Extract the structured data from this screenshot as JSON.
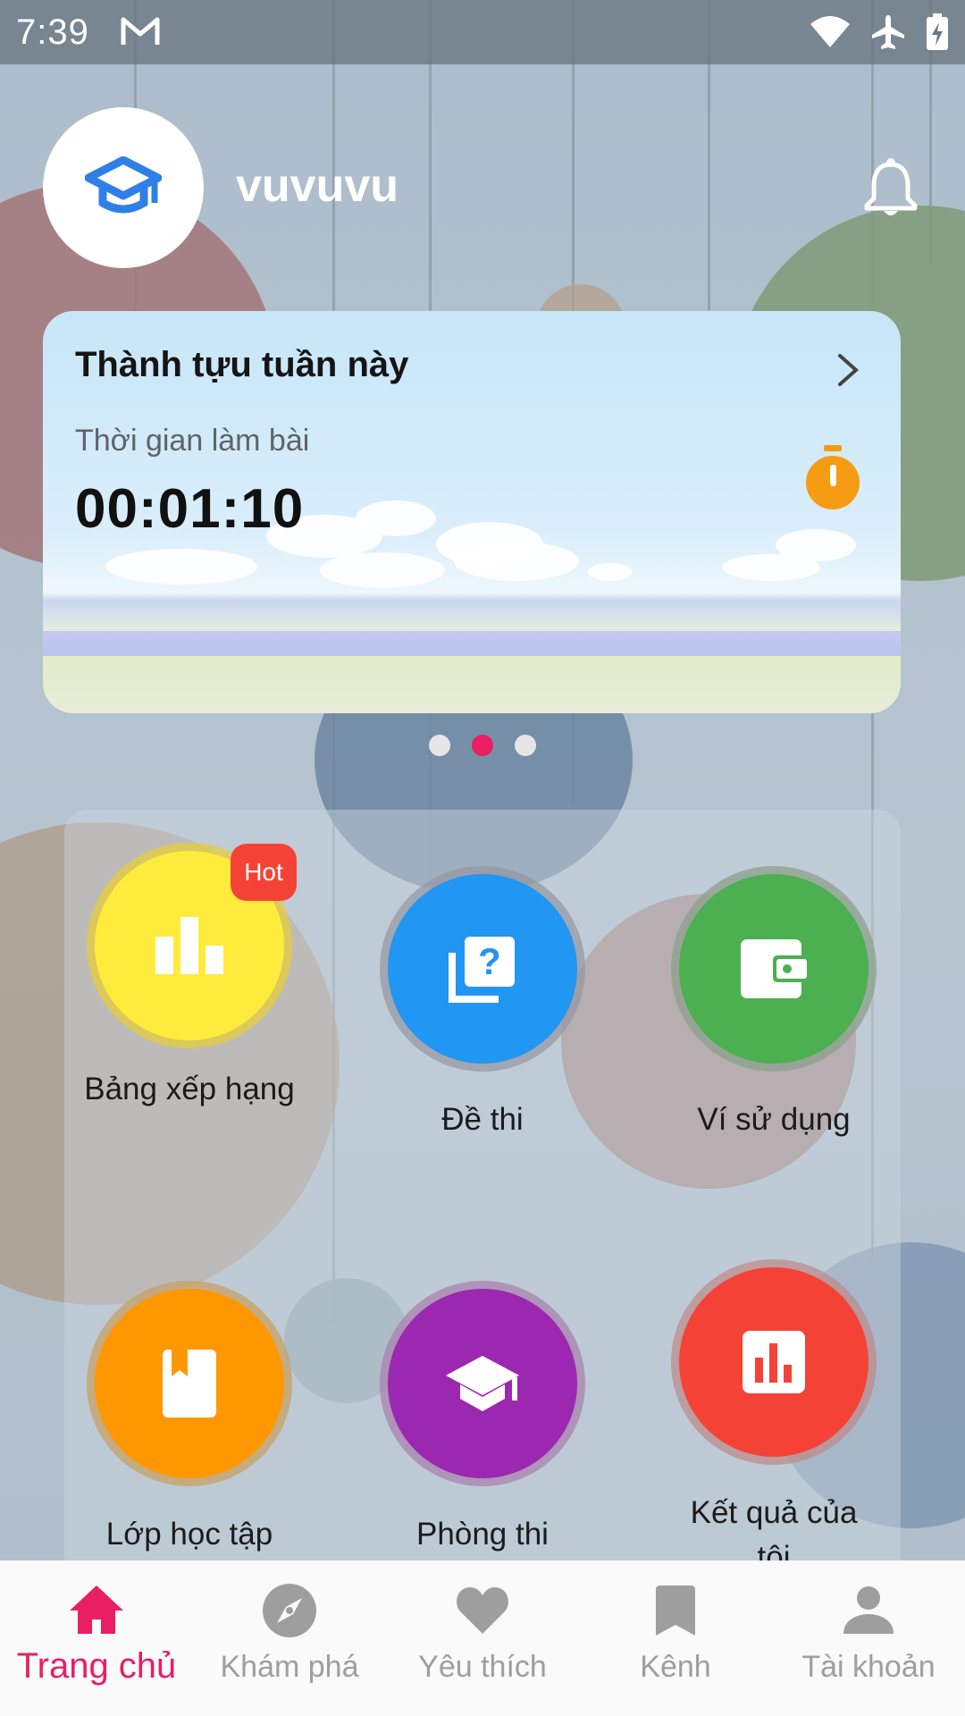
{
  "status_bar": {
    "time": "7:39"
  },
  "header": {
    "username": "vuvuvu"
  },
  "achievement_card": {
    "title": "Thành tựu tuần này",
    "label": "Thời gian làm bài",
    "value": "00:01:10"
  },
  "carousel": {
    "page_count": 3,
    "active_index": 1
  },
  "menu": {
    "items": [
      {
        "label": "Bảng xếp hạng",
        "color": "#ffeb3b",
        "icon": "leaderboard-icon",
        "badge": "Hot"
      },
      {
        "label": "Đề thi",
        "color": "#2196f3",
        "icon": "quiz-icon"
      },
      {
        "label": "Ví sử dụng",
        "color": "#4caf50",
        "icon": "wallet-icon"
      },
      {
        "label": "Lớp học tập",
        "color": "#ff9800",
        "icon": "book-icon"
      },
      {
        "label": "Phòng thi",
        "color": "#9c27b0",
        "icon": "school-icon"
      },
      {
        "label": "Kết quả của tôi",
        "color": "#f44336",
        "icon": "chart-icon"
      }
    ]
  },
  "bottom_nav": {
    "active_color": "#e91e63",
    "items": [
      {
        "label": "Trang chủ",
        "icon": "home-icon",
        "active": true
      },
      {
        "label": "Khám phá",
        "icon": "compass-icon"
      },
      {
        "label": "Yêu thích",
        "icon": "heart-icon"
      },
      {
        "label": "Kênh",
        "icon": "bookmark-icon"
      },
      {
        "label": "Tài khoản",
        "icon": "person-icon"
      }
    ]
  }
}
